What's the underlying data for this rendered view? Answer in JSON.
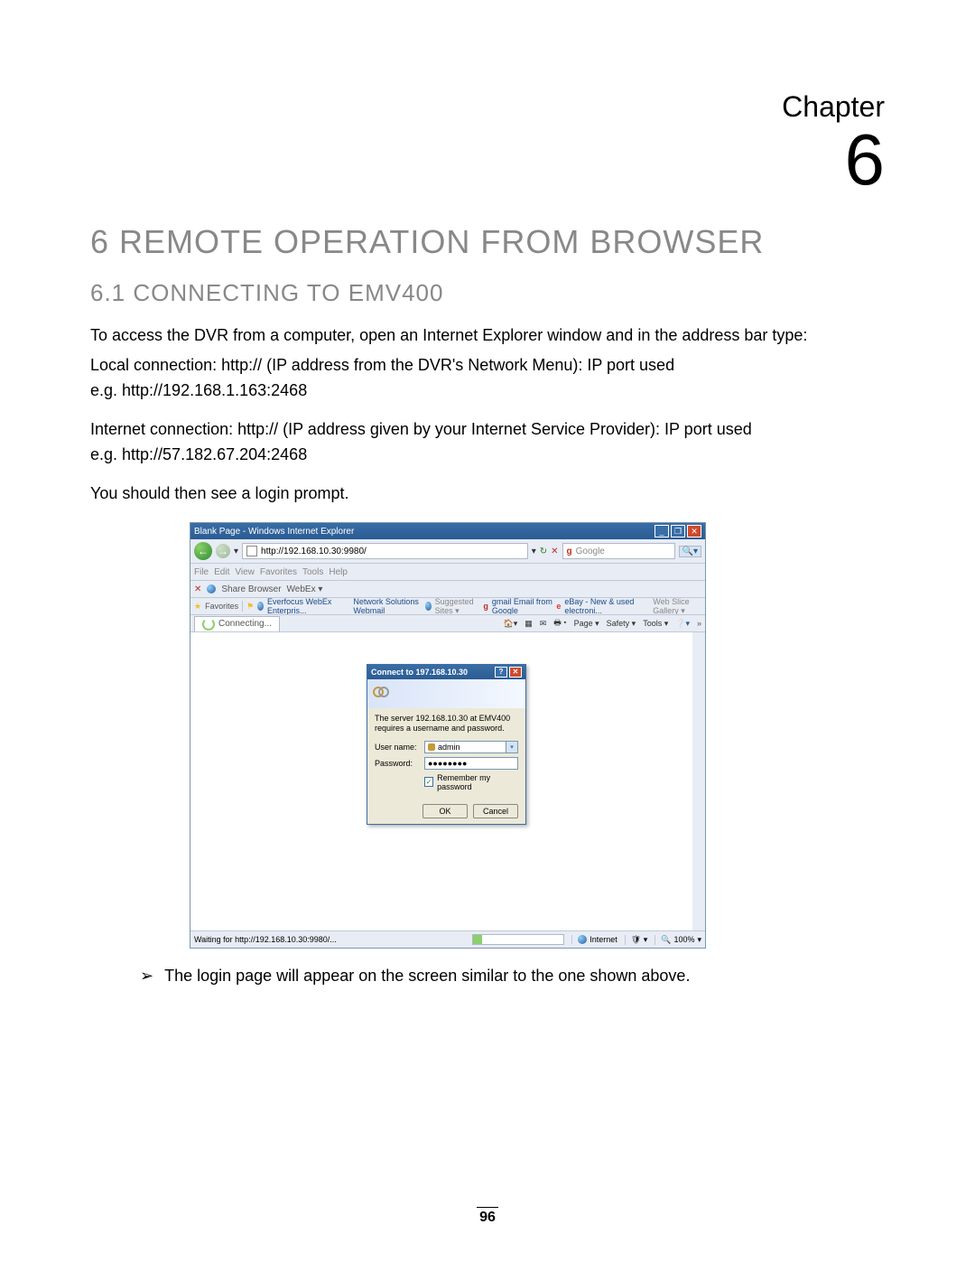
{
  "chapter_label": "Chapter",
  "chapter_number": "6",
  "heading": "6 REMOTE OPERATION FROM BROWSER",
  "subheading": "6.1 CONNECTING TO EMV400",
  "intro": "To access the DVR from a computer, open an Internet Explorer window and in the address bar type:",
  "local_conn_1": "Local connection: http:// (IP address from the DVR's Network Menu): IP port used",
  "local_conn_2": "e.g. http://192.168.1.163:2468",
  "internet_conn_1": "Internet connection: http:// (IP address given by your Internet Service Provider): IP port used",
  "internet_conn_2": "e.g. http://57.182.67.204:2468",
  "prompt_note": "You should then see a login prompt.",
  "bullet_text": "The login page will appear on the screen similar to the one shown above.",
  "page_number": "96",
  "ie": {
    "title": "Blank Page - Windows Internet Explorer",
    "url": "http://192.168.10.30:9980/",
    "search_placeholder": "Google",
    "menu": [
      "File",
      "Edit",
      "View",
      "Favorites",
      "Tools",
      "Help"
    ],
    "sharebar": [
      "Share Browser",
      "WebEx ▾"
    ],
    "fav_label": "Favorites",
    "fav_links": [
      "Everfocus WebEx Enterpris...",
      "Network Solutions Webmail",
      "Suggested Sites ▾",
      "gmail Email from Google",
      "eBay - New & used electroni...",
      "Web Slice Gallery ▾"
    ],
    "tab_label": "Connecting...",
    "cmdbar": [
      "Page ▾",
      "Safety ▾",
      "Tools ▾"
    ],
    "status": "Waiting for http://192.168.10.30:9980/...",
    "zone": "Internet",
    "zoom": "100%"
  },
  "auth": {
    "title": "Connect to 197.168.10.30",
    "message": "The server 192.168.10.30 at  EMV400 requires a username and password.",
    "username_label": "User name:",
    "username_value": "admin",
    "password_label": "Password:",
    "password_value": "●●●●●●●●",
    "remember": "Remember my password",
    "ok": "OK",
    "cancel": "Cancel"
  }
}
